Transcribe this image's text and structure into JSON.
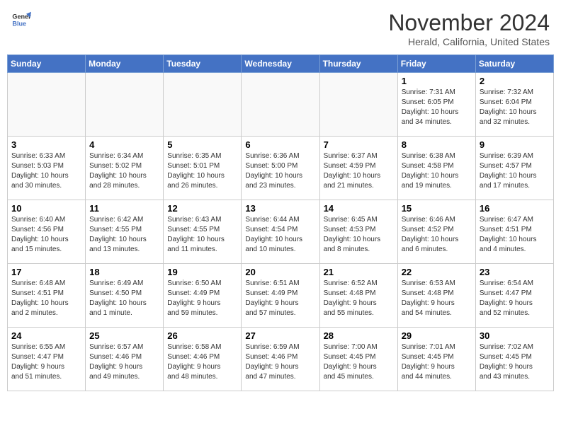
{
  "header": {
    "logo_line1": "General",
    "logo_line2": "Blue",
    "month": "November 2024",
    "location": "Herald, California, United States"
  },
  "weekdays": [
    "Sunday",
    "Monday",
    "Tuesday",
    "Wednesday",
    "Thursday",
    "Friday",
    "Saturday"
  ],
  "weeks": [
    [
      {
        "day": "",
        "info": ""
      },
      {
        "day": "",
        "info": ""
      },
      {
        "day": "",
        "info": ""
      },
      {
        "day": "",
        "info": ""
      },
      {
        "day": "",
        "info": ""
      },
      {
        "day": "1",
        "info": "Sunrise: 7:31 AM\nSunset: 6:05 PM\nDaylight: 10 hours\nand 34 minutes."
      },
      {
        "day": "2",
        "info": "Sunrise: 7:32 AM\nSunset: 6:04 PM\nDaylight: 10 hours\nand 32 minutes."
      }
    ],
    [
      {
        "day": "3",
        "info": "Sunrise: 6:33 AM\nSunset: 5:03 PM\nDaylight: 10 hours\nand 30 minutes."
      },
      {
        "day": "4",
        "info": "Sunrise: 6:34 AM\nSunset: 5:02 PM\nDaylight: 10 hours\nand 28 minutes."
      },
      {
        "day": "5",
        "info": "Sunrise: 6:35 AM\nSunset: 5:01 PM\nDaylight: 10 hours\nand 26 minutes."
      },
      {
        "day": "6",
        "info": "Sunrise: 6:36 AM\nSunset: 5:00 PM\nDaylight: 10 hours\nand 23 minutes."
      },
      {
        "day": "7",
        "info": "Sunrise: 6:37 AM\nSunset: 4:59 PM\nDaylight: 10 hours\nand 21 minutes."
      },
      {
        "day": "8",
        "info": "Sunrise: 6:38 AM\nSunset: 4:58 PM\nDaylight: 10 hours\nand 19 minutes."
      },
      {
        "day": "9",
        "info": "Sunrise: 6:39 AM\nSunset: 4:57 PM\nDaylight: 10 hours\nand 17 minutes."
      }
    ],
    [
      {
        "day": "10",
        "info": "Sunrise: 6:40 AM\nSunset: 4:56 PM\nDaylight: 10 hours\nand 15 minutes."
      },
      {
        "day": "11",
        "info": "Sunrise: 6:42 AM\nSunset: 4:55 PM\nDaylight: 10 hours\nand 13 minutes."
      },
      {
        "day": "12",
        "info": "Sunrise: 6:43 AM\nSunset: 4:55 PM\nDaylight: 10 hours\nand 11 minutes."
      },
      {
        "day": "13",
        "info": "Sunrise: 6:44 AM\nSunset: 4:54 PM\nDaylight: 10 hours\nand 10 minutes."
      },
      {
        "day": "14",
        "info": "Sunrise: 6:45 AM\nSunset: 4:53 PM\nDaylight: 10 hours\nand 8 minutes."
      },
      {
        "day": "15",
        "info": "Sunrise: 6:46 AM\nSunset: 4:52 PM\nDaylight: 10 hours\nand 6 minutes."
      },
      {
        "day": "16",
        "info": "Sunrise: 6:47 AM\nSunset: 4:51 PM\nDaylight: 10 hours\nand 4 minutes."
      }
    ],
    [
      {
        "day": "17",
        "info": "Sunrise: 6:48 AM\nSunset: 4:51 PM\nDaylight: 10 hours\nand 2 minutes."
      },
      {
        "day": "18",
        "info": "Sunrise: 6:49 AM\nSunset: 4:50 PM\nDaylight: 10 hours\nand 1 minute."
      },
      {
        "day": "19",
        "info": "Sunrise: 6:50 AM\nSunset: 4:49 PM\nDaylight: 9 hours\nand 59 minutes."
      },
      {
        "day": "20",
        "info": "Sunrise: 6:51 AM\nSunset: 4:49 PM\nDaylight: 9 hours\nand 57 minutes."
      },
      {
        "day": "21",
        "info": "Sunrise: 6:52 AM\nSunset: 4:48 PM\nDaylight: 9 hours\nand 55 minutes."
      },
      {
        "day": "22",
        "info": "Sunrise: 6:53 AM\nSunset: 4:48 PM\nDaylight: 9 hours\nand 54 minutes."
      },
      {
        "day": "23",
        "info": "Sunrise: 6:54 AM\nSunset: 4:47 PM\nDaylight: 9 hours\nand 52 minutes."
      }
    ],
    [
      {
        "day": "24",
        "info": "Sunrise: 6:55 AM\nSunset: 4:47 PM\nDaylight: 9 hours\nand 51 minutes."
      },
      {
        "day": "25",
        "info": "Sunrise: 6:57 AM\nSunset: 4:46 PM\nDaylight: 9 hours\nand 49 minutes."
      },
      {
        "day": "26",
        "info": "Sunrise: 6:58 AM\nSunset: 4:46 PM\nDaylight: 9 hours\nand 48 minutes."
      },
      {
        "day": "27",
        "info": "Sunrise: 6:59 AM\nSunset: 4:46 PM\nDaylight: 9 hours\nand 47 minutes."
      },
      {
        "day": "28",
        "info": "Sunrise: 7:00 AM\nSunset: 4:45 PM\nDaylight: 9 hours\nand 45 minutes."
      },
      {
        "day": "29",
        "info": "Sunrise: 7:01 AM\nSunset: 4:45 PM\nDaylight: 9 hours\nand 44 minutes."
      },
      {
        "day": "30",
        "info": "Sunrise: 7:02 AM\nSunset: 4:45 PM\nDaylight: 9 hours\nand 43 minutes."
      }
    ]
  ]
}
